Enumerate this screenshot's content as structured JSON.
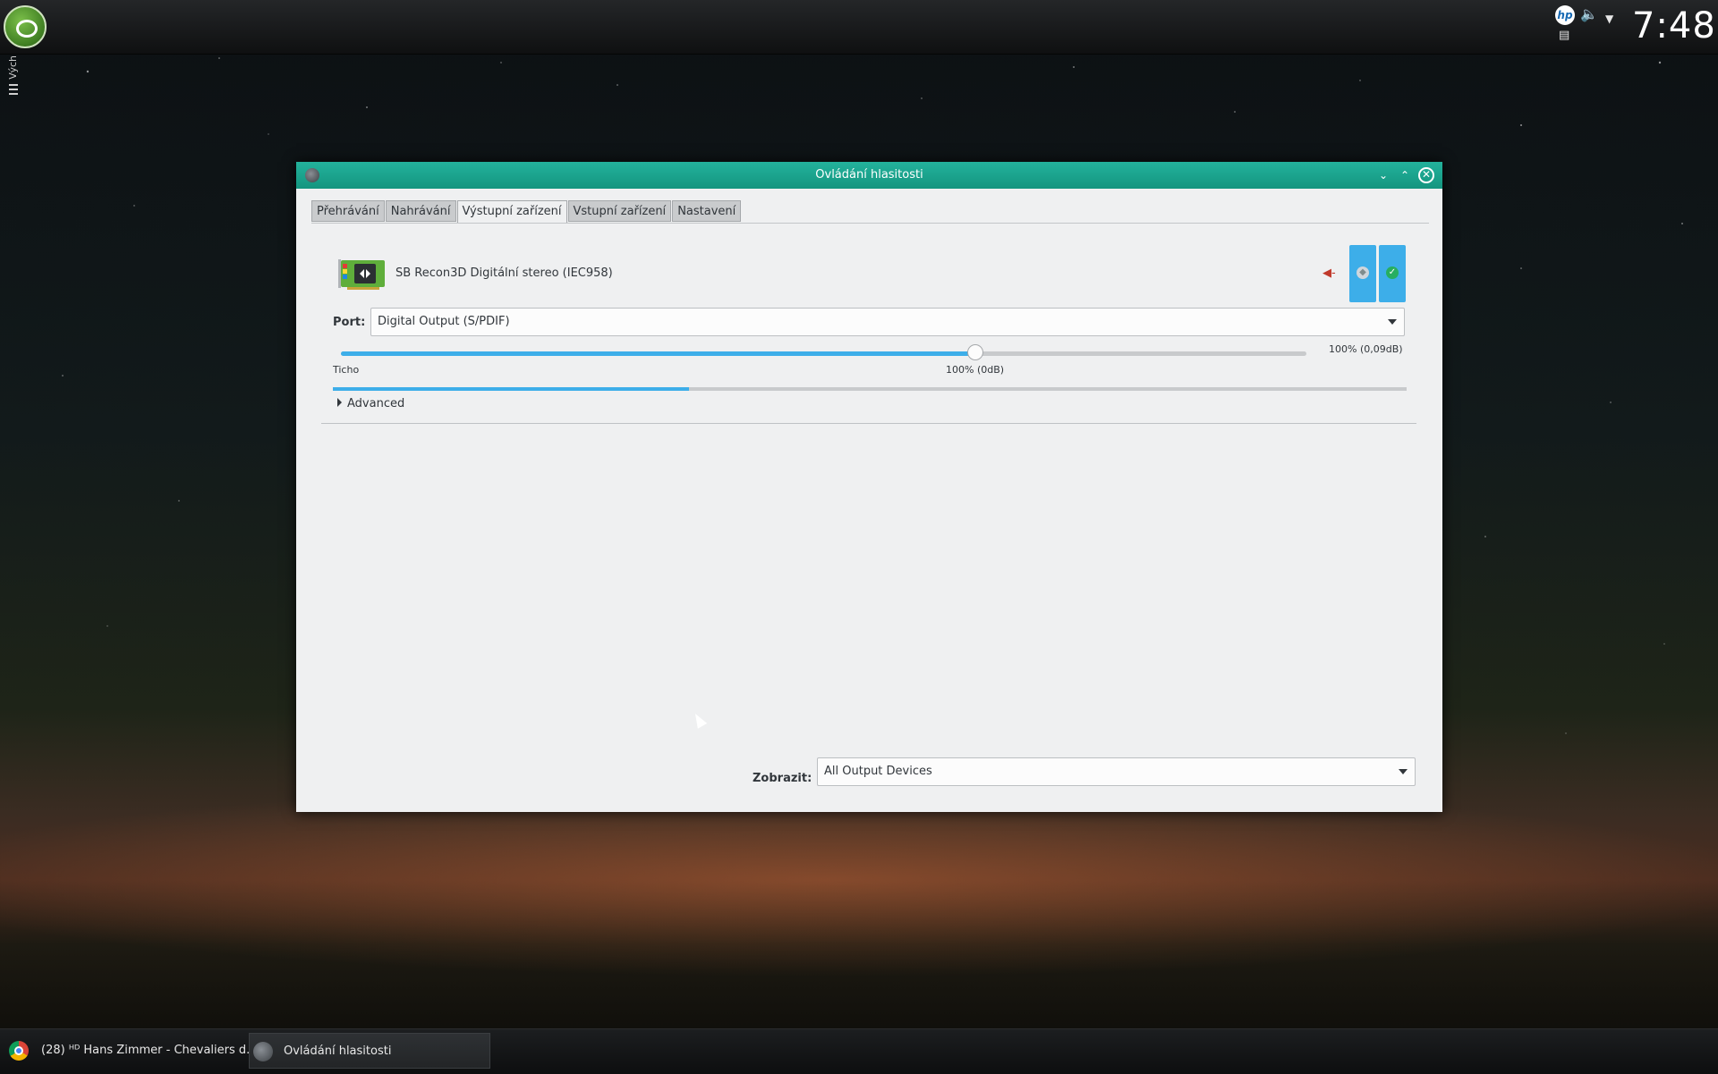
{
  "topbar": {
    "clock": "7:48",
    "tray_icons": [
      "hp-icon",
      "speaker-icon",
      "clipboard-icon",
      "tray-expand-icon"
    ]
  },
  "side_panel": {
    "label": "Vých"
  },
  "window": {
    "title": "Ovládání hlasitosti",
    "tabs": [
      {
        "label": "Přehrávání",
        "active": false
      },
      {
        "label": "Nahrávání",
        "active": false
      },
      {
        "label": "Výstupní zařízení",
        "active": true
      },
      {
        "label": "Vstupní zařízení",
        "active": false
      },
      {
        "label": "Nastavení",
        "active": false
      }
    ],
    "device": {
      "name": "SB Recon3D Digitální stereo (IEC958)",
      "port_label": "Port:",
      "port_value": "Digital Output (S/PDIF)",
      "volume_value": "100% (0,09dB)",
      "volume_fraction": 0.657,
      "peak_fraction": 0.332,
      "silent_label": "Ticho",
      "hundred_label": "100% (0dB)",
      "advanced_label": "Advanced"
    },
    "footer": {
      "show_label": "Zobrazit:",
      "show_value": "All Output Devices"
    }
  },
  "taskbar": {
    "tasks": [
      {
        "label": "(28) ᴴᴰ Hans Zimmer - Chevaliers d...",
        "icon": "chrome-icon",
        "active": false
      },
      {
        "label": "Ovládání hlasitosti",
        "icon": "pulseaudio-icon",
        "active": true
      }
    ]
  },
  "colors": {
    "accent": "#3daee9",
    "titlebar": "#1aa38d",
    "window_bg": "#eff0f1"
  }
}
